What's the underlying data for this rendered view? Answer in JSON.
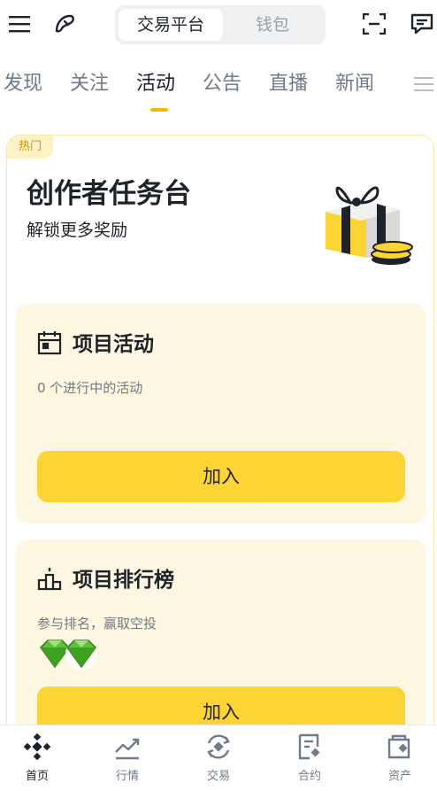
{
  "header": {
    "segments": [
      {
        "label": "交易平台",
        "active": true
      },
      {
        "label": "钱包",
        "active": false
      }
    ],
    "icons": [
      "menu-icon",
      "logo-icon",
      "scan-icon",
      "message-icon"
    ]
  },
  "tabs": [
    {
      "label": "发现",
      "active": false
    },
    {
      "label": "关注",
      "active": false
    },
    {
      "label": "活动",
      "active": true
    },
    {
      "label": "公告",
      "active": false
    },
    {
      "label": "直播",
      "active": false
    },
    {
      "label": "新闻",
      "active": false
    }
  ],
  "card": {
    "badge": "热门",
    "title": "创作者任务台",
    "subtitle": "解锁更多奖励",
    "panels": [
      {
        "title": "项目活动",
        "desc": "0 个进行中的活动",
        "button": "加入",
        "icon": "calendar-icon"
      },
      {
        "title": "项目排行榜",
        "desc": "参与排名，赢取空投",
        "button": "加入",
        "icon": "podium-icon"
      }
    ]
  },
  "bottom_nav": [
    {
      "label": "首页",
      "icon": "home-icon",
      "active": true
    },
    {
      "label": "行情",
      "icon": "markets-icon",
      "active": false
    },
    {
      "label": "交易",
      "icon": "trade-icon",
      "active": false
    },
    {
      "label": "合约",
      "icon": "futures-icon",
      "active": false
    },
    {
      "label": "资产",
      "icon": "wallet-icon",
      "active": false
    }
  ],
  "colors": {
    "accent": "#fcd535",
    "tab_underline": "#f0b90b",
    "panel_bg": "#fdf6e0",
    "badge_bg": "#fdf1c6"
  }
}
